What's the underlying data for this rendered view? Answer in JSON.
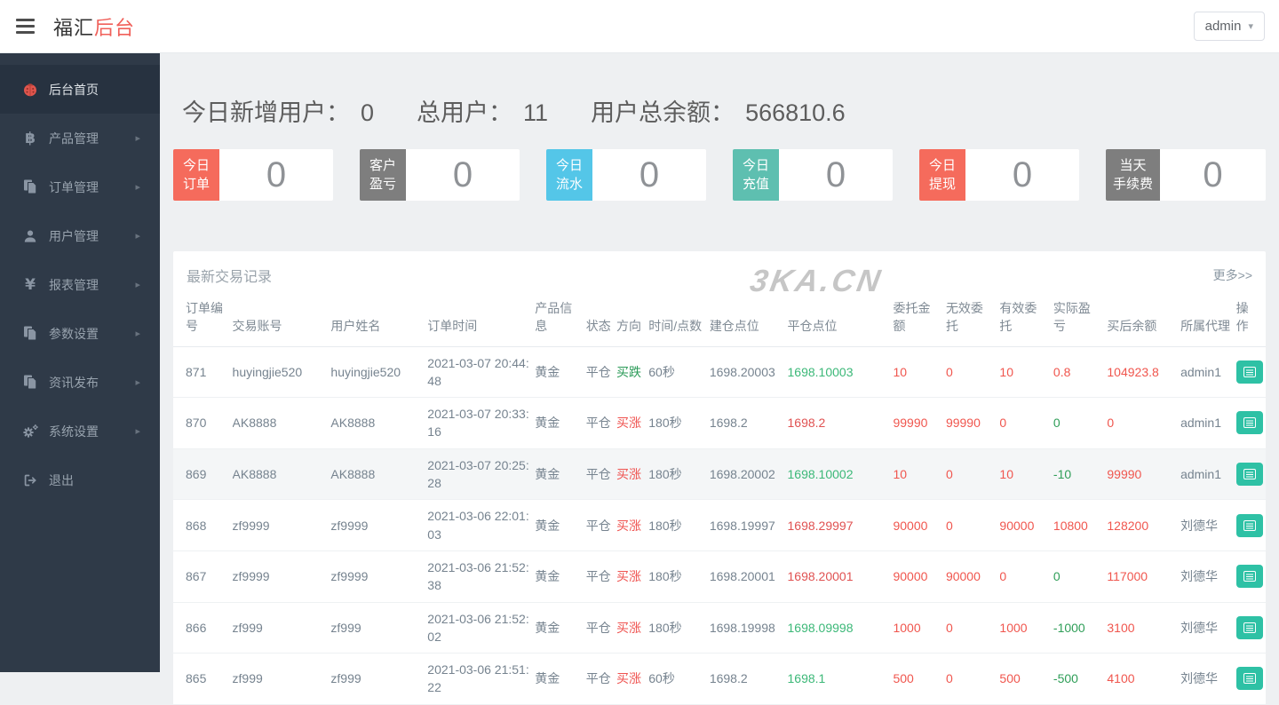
{
  "header": {
    "brand_black": "福汇",
    "brand_red": "后台",
    "user_menu_label": "admin"
  },
  "sidebar": {
    "items": [
      {
        "label": "后台首页",
        "icon": "ladybug-icon",
        "active": true,
        "has_arrow": false
      },
      {
        "label": "产品管理",
        "icon": "bitcoin-icon",
        "active": false,
        "has_arrow": true
      },
      {
        "label": "订单管理",
        "icon": "documents-icon",
        "active": false,
        "has_arrow": true
      },
      {
        "label": "用户管理",
        "icon": "user-icon",
        "active": false,
        "has_arrow": true
      },
      {
        "label": "报表管理",
        "icon": "yen-icon",
        "active": false,
        "has_arrow": true
      },
      {
        "label": "参数设置",
        "icon": "documents-icon",
        "active": false,
        "has_arrow": true
      },
      {
        "label": "资讯发布",
        "icon": "documents-icon",
        "active": false,
        "has_arrow": true
      },
      {
        "label": "系统设置",
        "icon": "gears-icon",
        "active": false,
        "has_arrow": true
      },
      {
        "label": "退出",
        "icon": "logout-icon",
        "active": false,
        "has_arrow": false
      }
    ]
  },
  "overview": {
    "stats": [
      {
        "label": "今日新增用户：",
        "value": "0"
      },
      {
        "label": "总用户：",
        "value": "11"
      },
      {
        "label": "用户总余额：",
        "value": "566810.6"
      }
    ],
    "cards": [
      {
        "label": "今日\n订单",
        "value": "0",
        "color": "#f56b5c"
      },
      {
        "label": "客户\n盈亏",
        "value": "0",
        "color": "#7e7e7e"
      },
      {
        "label": "今日\n流水",
        "value": "0",
        "color": "#54c6e8"
      },
      {
        "label": "今日\n充值",
        "value": "0",
        "color": "#5ebfb0"
      },
      {
        "label": "今日\n提现",
        "value": "0",
        "color": "#f56b5c"
      },
      {
        "label": "当天\n手续费",
        "value": "0",
        "color": "#7e7e7e"
      }
    ]
  },
  "panel": {
    "title": "最新交易记录",
    "more_link": "更多>>",
    "watermark": "3KA.CN",
    "columns": [
      "订单编号",
      "交易账号",
      "用户姓名",
      "订单时间",
      "产品信息",
      "状态",
      "方向",
      "时间/点数",
      "建仓点位",
      "平仓点位",
      "委托金额",
      "无效委托",
      "有效委托",
      "实际盈亏",
      "买后余额",
      "所属代理",
      "操作"
    ],
    "rows": [
      {
        "highlight": false,
        "cells": [
          {
            "t": "871"
          },
          {
            "t": "huyingjie520"
          },
          {
            "t": "huyingjie520"
          },
          {
            "t": "2021-03-07 20:44:48"
          },
          {
            "t": "黄金"
          },
          {
            "t": "平仓"
          },
          {
            "t": "买跌",
            "c": "#2a9a57"
          },
          {
            "t": "60秒"
          },
          {
            "t": "1698.20003"
          },
          {
            "t": "1698.10003",
            "c": "#3cb878"
          },
          {
            "t": "10",
            "c": "#f0564e"
          },
          {
            "t": "0",
            "c": "#f0564e"
          },
          {
            "t": "10",
            "c": "#f0564e"
          },
          {
            "t": "0.8",
            "c": "#f0564e"
          },
          {
            "t": "104923.8",
            "c": "#f0564e"
          },
          {
            "t": "admin1"
          },
          {
            "action": "view-order-button"
          }
        ]
      },
      {
        "highlight": false,
        "cells": [
          {
            "t": "870"
          },
          {
            "t": "AK8888"
          },
          {
            "t": "AK8888"
          },
          {
            "t": "2021-03-07 20:33:16"
          },
          {
            "t": "黄金"
          },
          {
            "t": "平仓"
          },
          {
            "t": "买涨",
            "c": "#ef5350"
          },
          {
            "t": "180秒"
          },
          {
            "t": "1698.2"
          },
          {
            "t": "1698.2",
            "c": "#e05252"
          },
          {
            "t": "99990",
            "c": "#f0564e"
          },
          {
            "t": "99990",
            "c": "#f0564e"
          },
          {
            "t": "0",
            "c": "#f0564e"
          },
          {
            "t": "0",
            "c": "#2f9e58"
          },
          {
            "t": "0",
            "c": "#f0564e"
          },
          {
            "t": "admin1"
          },
          {
            "action": "view-order-button"
          }
        ]
      },
      {
        "highlight": true,
        "cells": [
          {
            "t": "869"
          },
          {
            "t": "AK8888"
          },
          {
            "t": "AK8888"
          },
          {
            "t": "2021-03-07 20:25:28"
          },
          {
            "t": "黄金"
          },
          {
            "t": "平仓"
          },
          {
            "t": "买涨",
            "c": "#ef5350"
          },
          {
            "t": "180秒"
          },
          {
            "t": "1698.20002"
          },
          {
            "t": "1698.10002",
            "c": "#3cb878"
          },
          {
            "t": "10",
            "c": "#f0564e"
          },
          {
            "t": "0",
            "c": "#f0564e"
          },
          {
            "t": "10",
            "c": "#f0564e"
          },
          {
            "t": "-10",
            "c": "#2f9e58"
          },
          {
            "t": "99990",
            "c": "#f0564e"
          },
          {
            "t": "admin1"
          },
          {
            "action": "view-order-button"
          }
        ]
      },
      {
        "highlight": false,
        "cells": [
          {
            "t": "868"
          },
          {
            "t": "zf9999"
          },
          {
            "t": "zf9999"
          },
          {
            "t": "2021-03-06 22:01:03"
          },
          {
            "t": "黄金"
          },
          {
            "t": "平仓"
          },
          {
            "t": "买涨",
            "c": "#ef5350"
          },
          {
            "t": "180秒"
          },
          {
            "t": "1698.19997"
          },
          {
            "t": "1698.29997",
            "c": "#e05252"
          },
          {
            "t": "90000",
            "c": "#f0564e"
          },
          {
            "t": "0",
            "c": "#f0564e"
          },
          {
            "t": "90000",
            "c": "#f0564e"
          },
          {
            "t": "10800",
            "c": "#f0564e"
          },
          {
            "t": "128200",
            "c": "#f0564e"
          },
          {
            "t": "刘德华"
          },
          {
            "action": "view-order-button"
          }
        ]
      },
      {
        "highlight": false,
        "cells": [
          {
            "t": "867"
          },
          {
            "t": "zf9999"
          },
          {
            "t": "zf9999"
          },
          {
            "t": "2021-03-06 21:52:38"
          },
          {
            "t": "黄金"
          },
          {
            "t": "平仓"
          },
          {
            "t": "买涨",
            "c": "#ef5350"
          },
          {
            "t": "180秒"
          },
          {
            "t": "1698.20001"
          },
          {
            "t": "1698.20001",
            "c": "#e05252"
          },
          {
            "t": "90000",
            "c": "#f0564e"
          },
          {
            "t": "90000",
            "c": "#f0564e"
          },
          {
            "t": "0",
            "c": "#f0564e"
          },
          {
            "t": "0",
            "c": "#2f9e58"
          },
          {
            "t": "117000",
            "c": "#f0564e"
          },
          {
            "t": "刘德华"
          },
          {
            "action": "view-order-button"
          }
        ]
      },
      {
        "highlight": false,
        "cells": [
          {
            "t": "866"
          },
          {
            "t": "zf999"
          },
          {
            "t": "zf999"
          },
          {
            "t": "2021-03-06 21:52:02"
          },
          {
            "t": "黄金"
          },
          {
            "t": "平仓"
          },
          {
            "t": "买涨",
            "c": "#ef5350"
          },
          {
            "t": "180秒"
          },
          {
            "t": "1698.19998"
          },
          {
            "t": "1698.09998",
            "c": "#3cb878"
          },
          {
            "t": "1000",
            "c": "#f0564e"
          },
          {
            "t": "0",
            "c": "#f0564e"
          },
          {
            "t": "1000",
            "c": "#f0564e"
          },
          {
            "t": "-1000",
            "c": "#2f9e58"
          },
          {
            "t": "3100",
            "c": "#f0564e"
          },
          {
            "t": "刘德华"
          },
          {
            "action": "view-order-button"
          }
        ]
      },
      {
        "highlight": false,
        "cells": [
          {
            "t": "865"
          },
          {
            "t": "zf999"
          },
          {
            "t": "zf999"
          },
          {
            "t": "2021-03-06 21:51:22"
          },
          {
            "t": "黄金"
          },
          {
            "t": "平仓"
          },
          {
            "t": "买涨",
            "c": "#ef5350"
          },
          {
            "t": "60秒"
          },
          {
            "t": "1698.2"
          },
          {
            "t": "1698.1",
            "c": "#3cb878"
          },
          {
            "t": "500",
            "c": "#f0564e"
          },
          {
            "t": "0",
            "c": "#f0564e"
          },
          {
            "t": "500",
            "c": "#f0564e"
          },
          {
            "t": "-500",
            "c": "#2f9e58"
          },
          {
            "t": "4100",
            "c": "#f0564e"
          },
          {
            "t": "刘德华"
          },
          {
            "action": "view-order-button"
          }
        ]
      }
    ]
  }
}
